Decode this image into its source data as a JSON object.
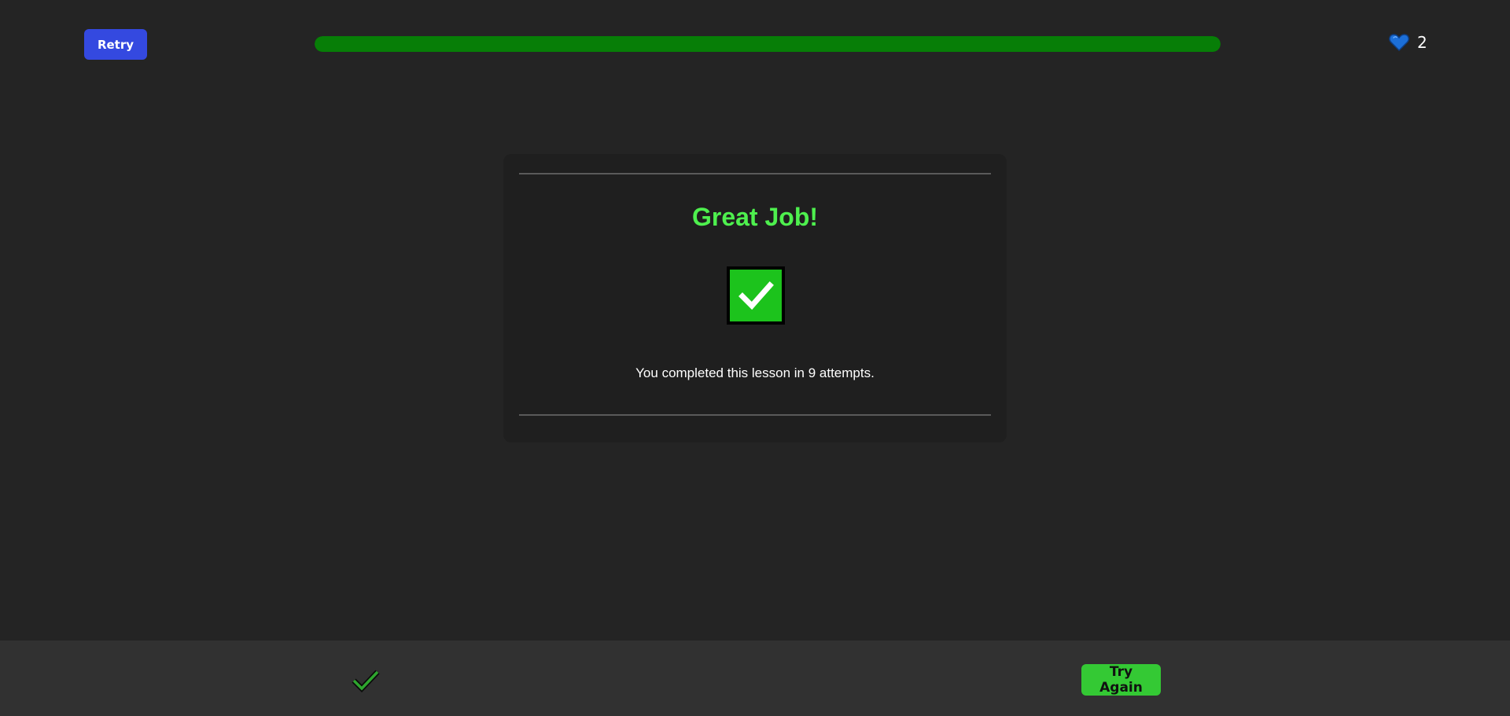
{
  "header": {
    "retry_label": "Retry",
    "progress_fraction": 1.0,
    "lives_icon": "heart-icon",
    "lives_count": "2"
  },
  "result": {
    "title": "Great Job!",
    "status_icon": "checkmark-icon",
    "message": "You completed this lesson in 9 attempts."
  },
  "footer": {
    "status_icon": "checkmark-icon",
    "try_again_label": "Try Again"
  },
  "colors": {
    "background": "#242424",
    "retry_button": "#3449e0",
    "progress_fill": "#077e07",
    "heart": "#1c6fd8",
    "title": "#4ef04e",
    "check_box": "#1cc31c",
    "footer": "#313131",
    "try_again_button": "#34c934"
  }
}
